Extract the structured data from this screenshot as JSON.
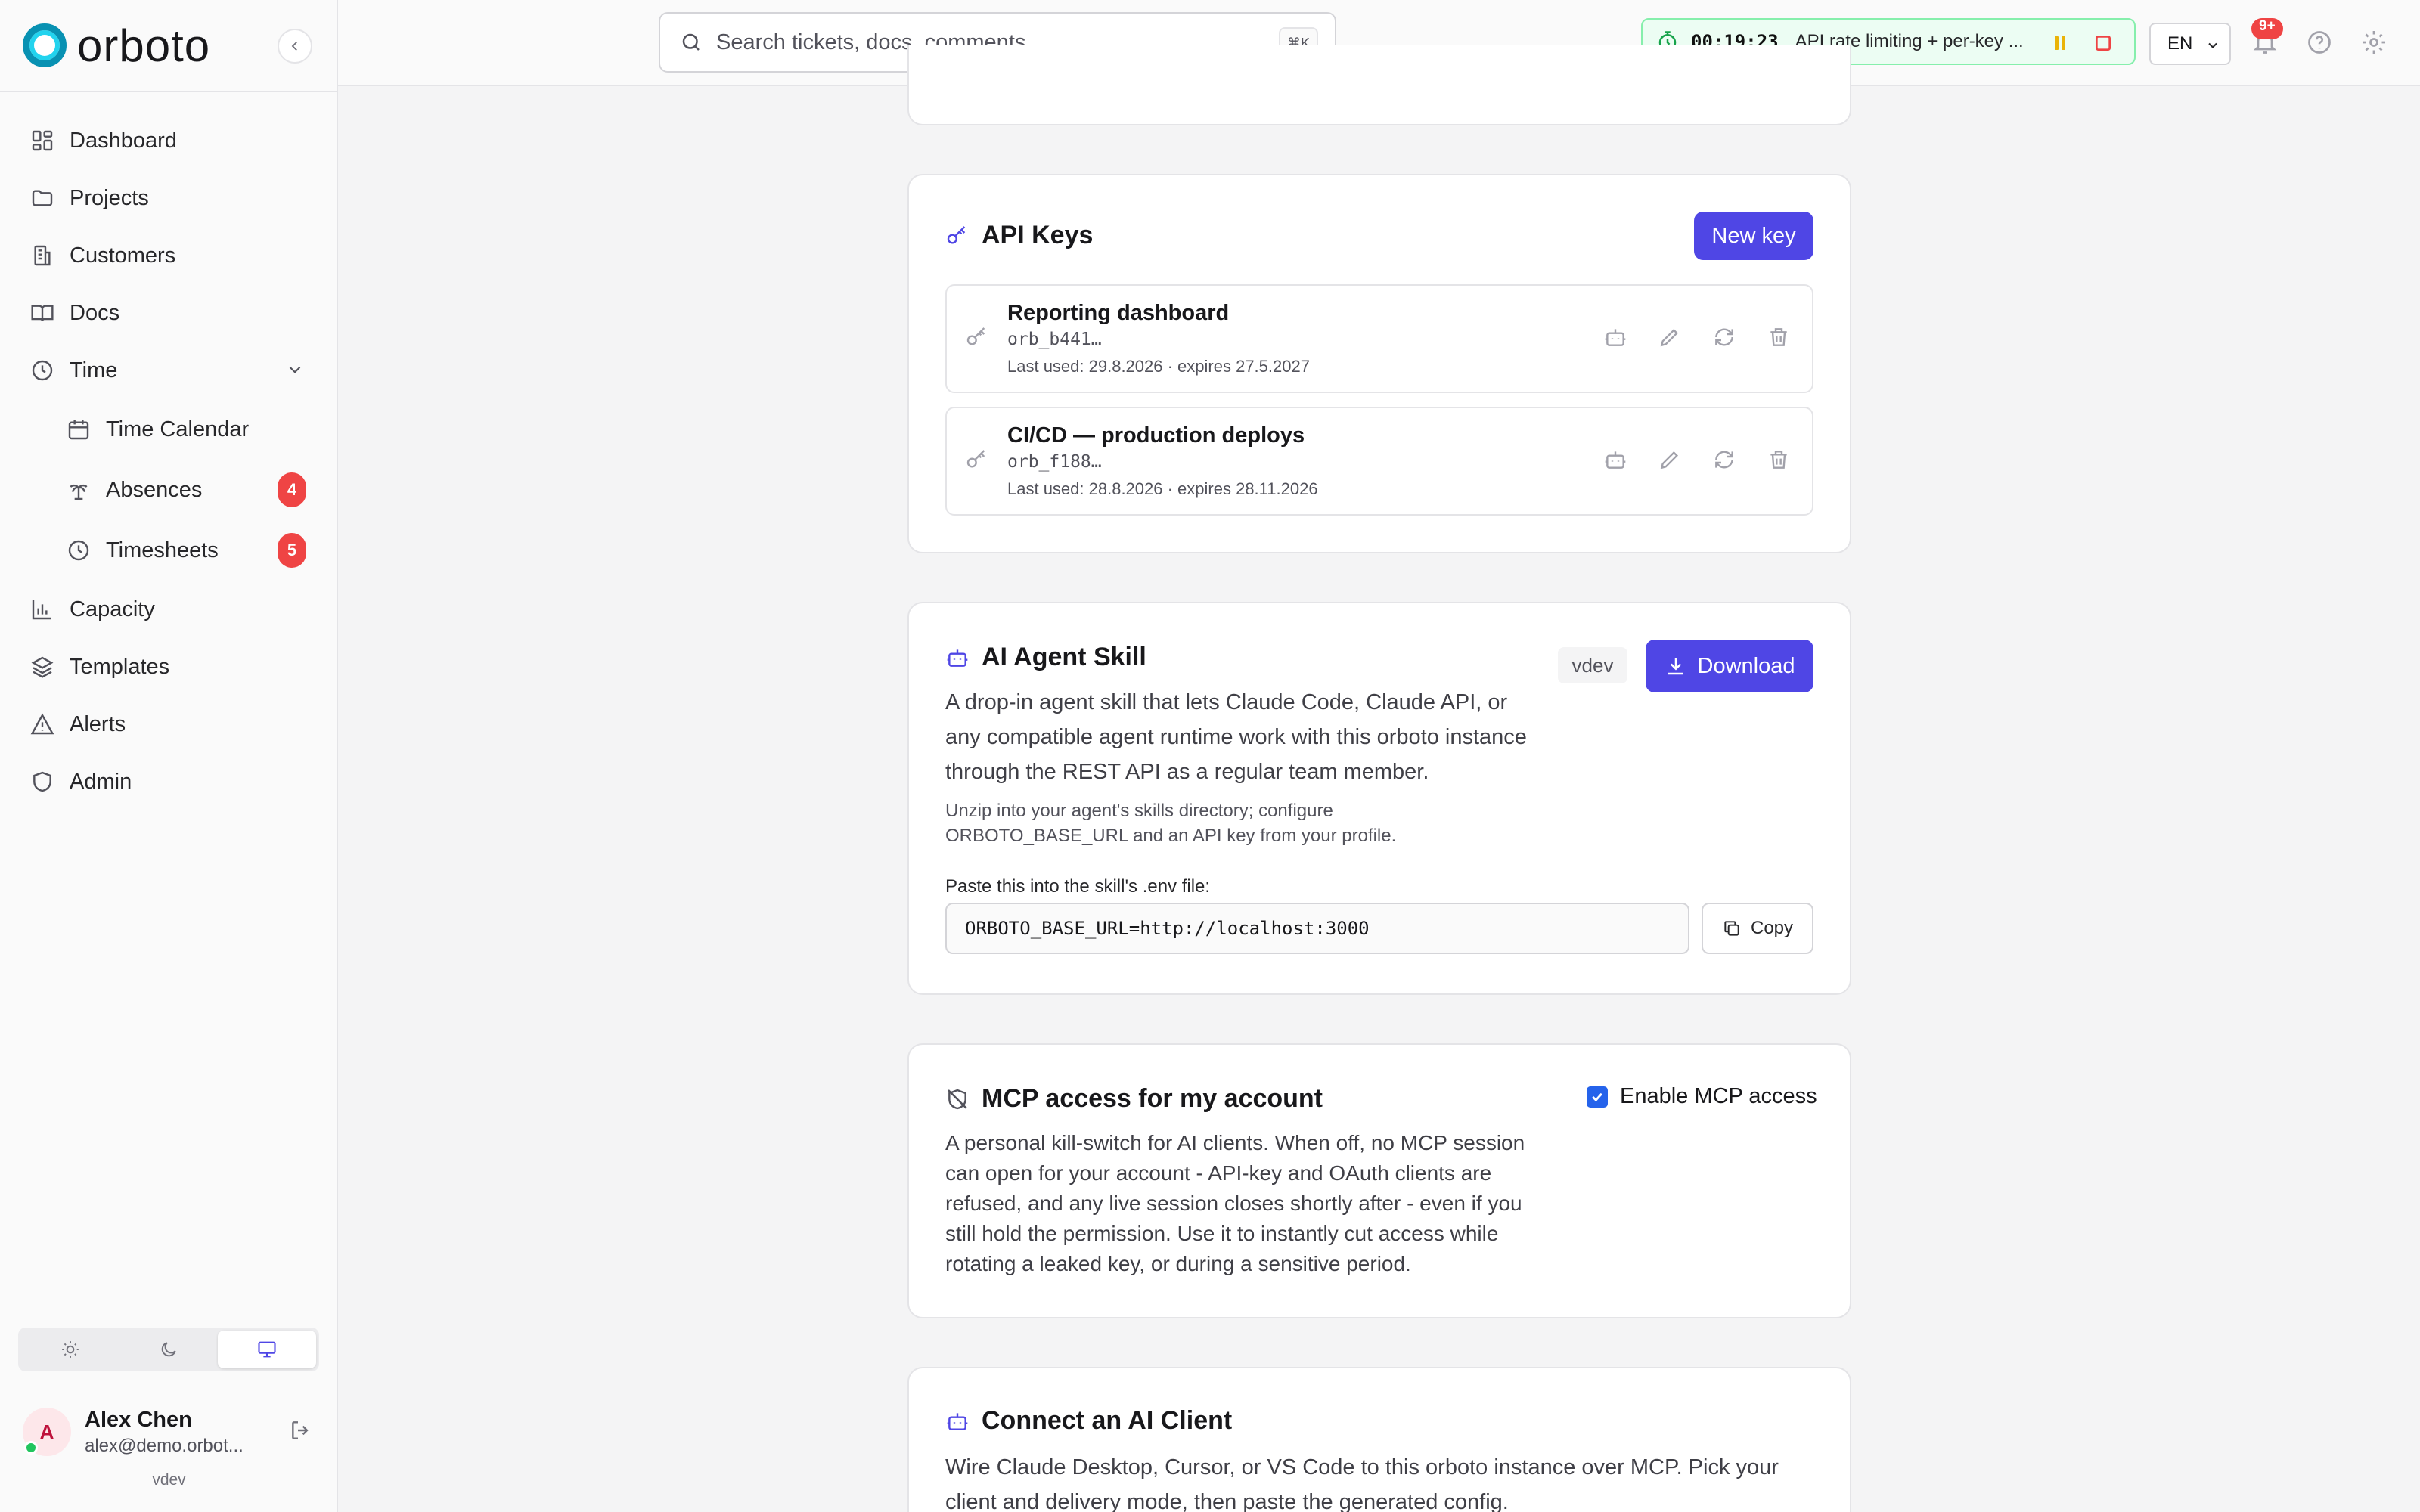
{
  "app": {
    "name": "orboto",
    "version": "vdev"
  },
  "sidebar": {
    "items": [
      {
        "label": "Dashboard",
        "icon": "dashboard-icon"
      },
      {
        "label": "Projects",
        "icon": "folder-icon"
      },
      {
        "label": "Customers",
        "icon": "building-icon"
      },
      {
        "label": "Docs",
        "icon": "book-icon"
      },
      {
        "label": "Time",
        "icon": "clock-icon",
        "expanded": true
      },
      {
        "label": "Time Calendar",
        "icon": "calendar-icon"
      },
      {
        "label": "Absences",
        "icon": "palm-tree-icon",
        "badge": "4"
      },
      {
        "label": "Timesheets",
        "icon": "clock-icon",
        "badge": "5"
      },
      {
        "label": "Capacity",
        "icon": "bar-chart-icon"
      },
      {
        "label": "Templates",
        "icon": "layers-icon"
      },
      {
        "label": "Alerts",
        "icon": "alert-triangle-icon"
      },
      {
        "label": "Admin",
        "icon": "shield-icon"
      }
    ],
    "theme_options": [
      "light",
      "dark",
      "system"
    ],
    "theme_selected": "system",
    "user": {
      "initial": "A",
      "name": "Alex Chen",
      "email": "alex@demo.orbot..."
    }
  },
  "header": {
    "search_placeholder": "Search tickets, docs, comments...",
    "search_shortcut": "⌘K",
    "timer": {
      "time": "00:19:23",
      "task": "API rate limiting + per-key ..."
    },
    "language": "EN",
    "notifications_badge": "9+"
  },
  "api_keys": {
    "title": "API Keys",
    "new_button": "New key",
    "keys": [
      {
        "name": "Reporting dashboard",
        "prefix": "orb_b441…",
        "meta": "Last used: 29.8.2026 · expires 27.5.2027"
      },
      {
        "name": "CI/CD — production deploys",
        "prefix": "orb_f188…",
        "meta": "Last used: 28.8.2026 · expires 28.11.2026"
      }
    ]
  },
  "agent_skill": {
    "title": "AI Agent Skill",
    "version": "vdev",
    "download_button": "Download",
    "description": "A drop-in agent skill that lets Claude Code, Claude API, or any compatible agent runtime work with this orboto instance through the REST API as a regular team member.",
    "hint": "Unzip into your agent's skills directory; configure ORBOTO_BASE_URL and an API key from your profile.",
    "env_label": "Paste this into the skill's .env file:",
    "env_value": "ORBOTO_BASE_URL=http://localhost:3000",
    "copy_button": "Copy"
  },
  "mcp_access": {
    "title": "MCP access for my account",
    "toggle_label": "Enable MCP access",
    "enabled": true,
    "description": "A personal kill-switch for AI clients. When off, no MCP session can open for your account - API-key and OAuth clients are refused, and any live session closes shortly after - even if you still hold the permission. Use it to instantly cut access while rotating a leaked key, or during a sensitive period."
  },
  "connect_client": {
    "title": "Connect an AI Client",
    "description": "Wire Claude Desktop, Cursor, or VS Code to this orboto instance over MCP. Pick your client and delivery mode, then paste the generated config."
  },
  "colors": {
    "accent": "#4f46e5",
    "brand": "#0891b2",
    "badge": "#ef4444",
    "timer_bg": "#ecfdf3"
  }
}
